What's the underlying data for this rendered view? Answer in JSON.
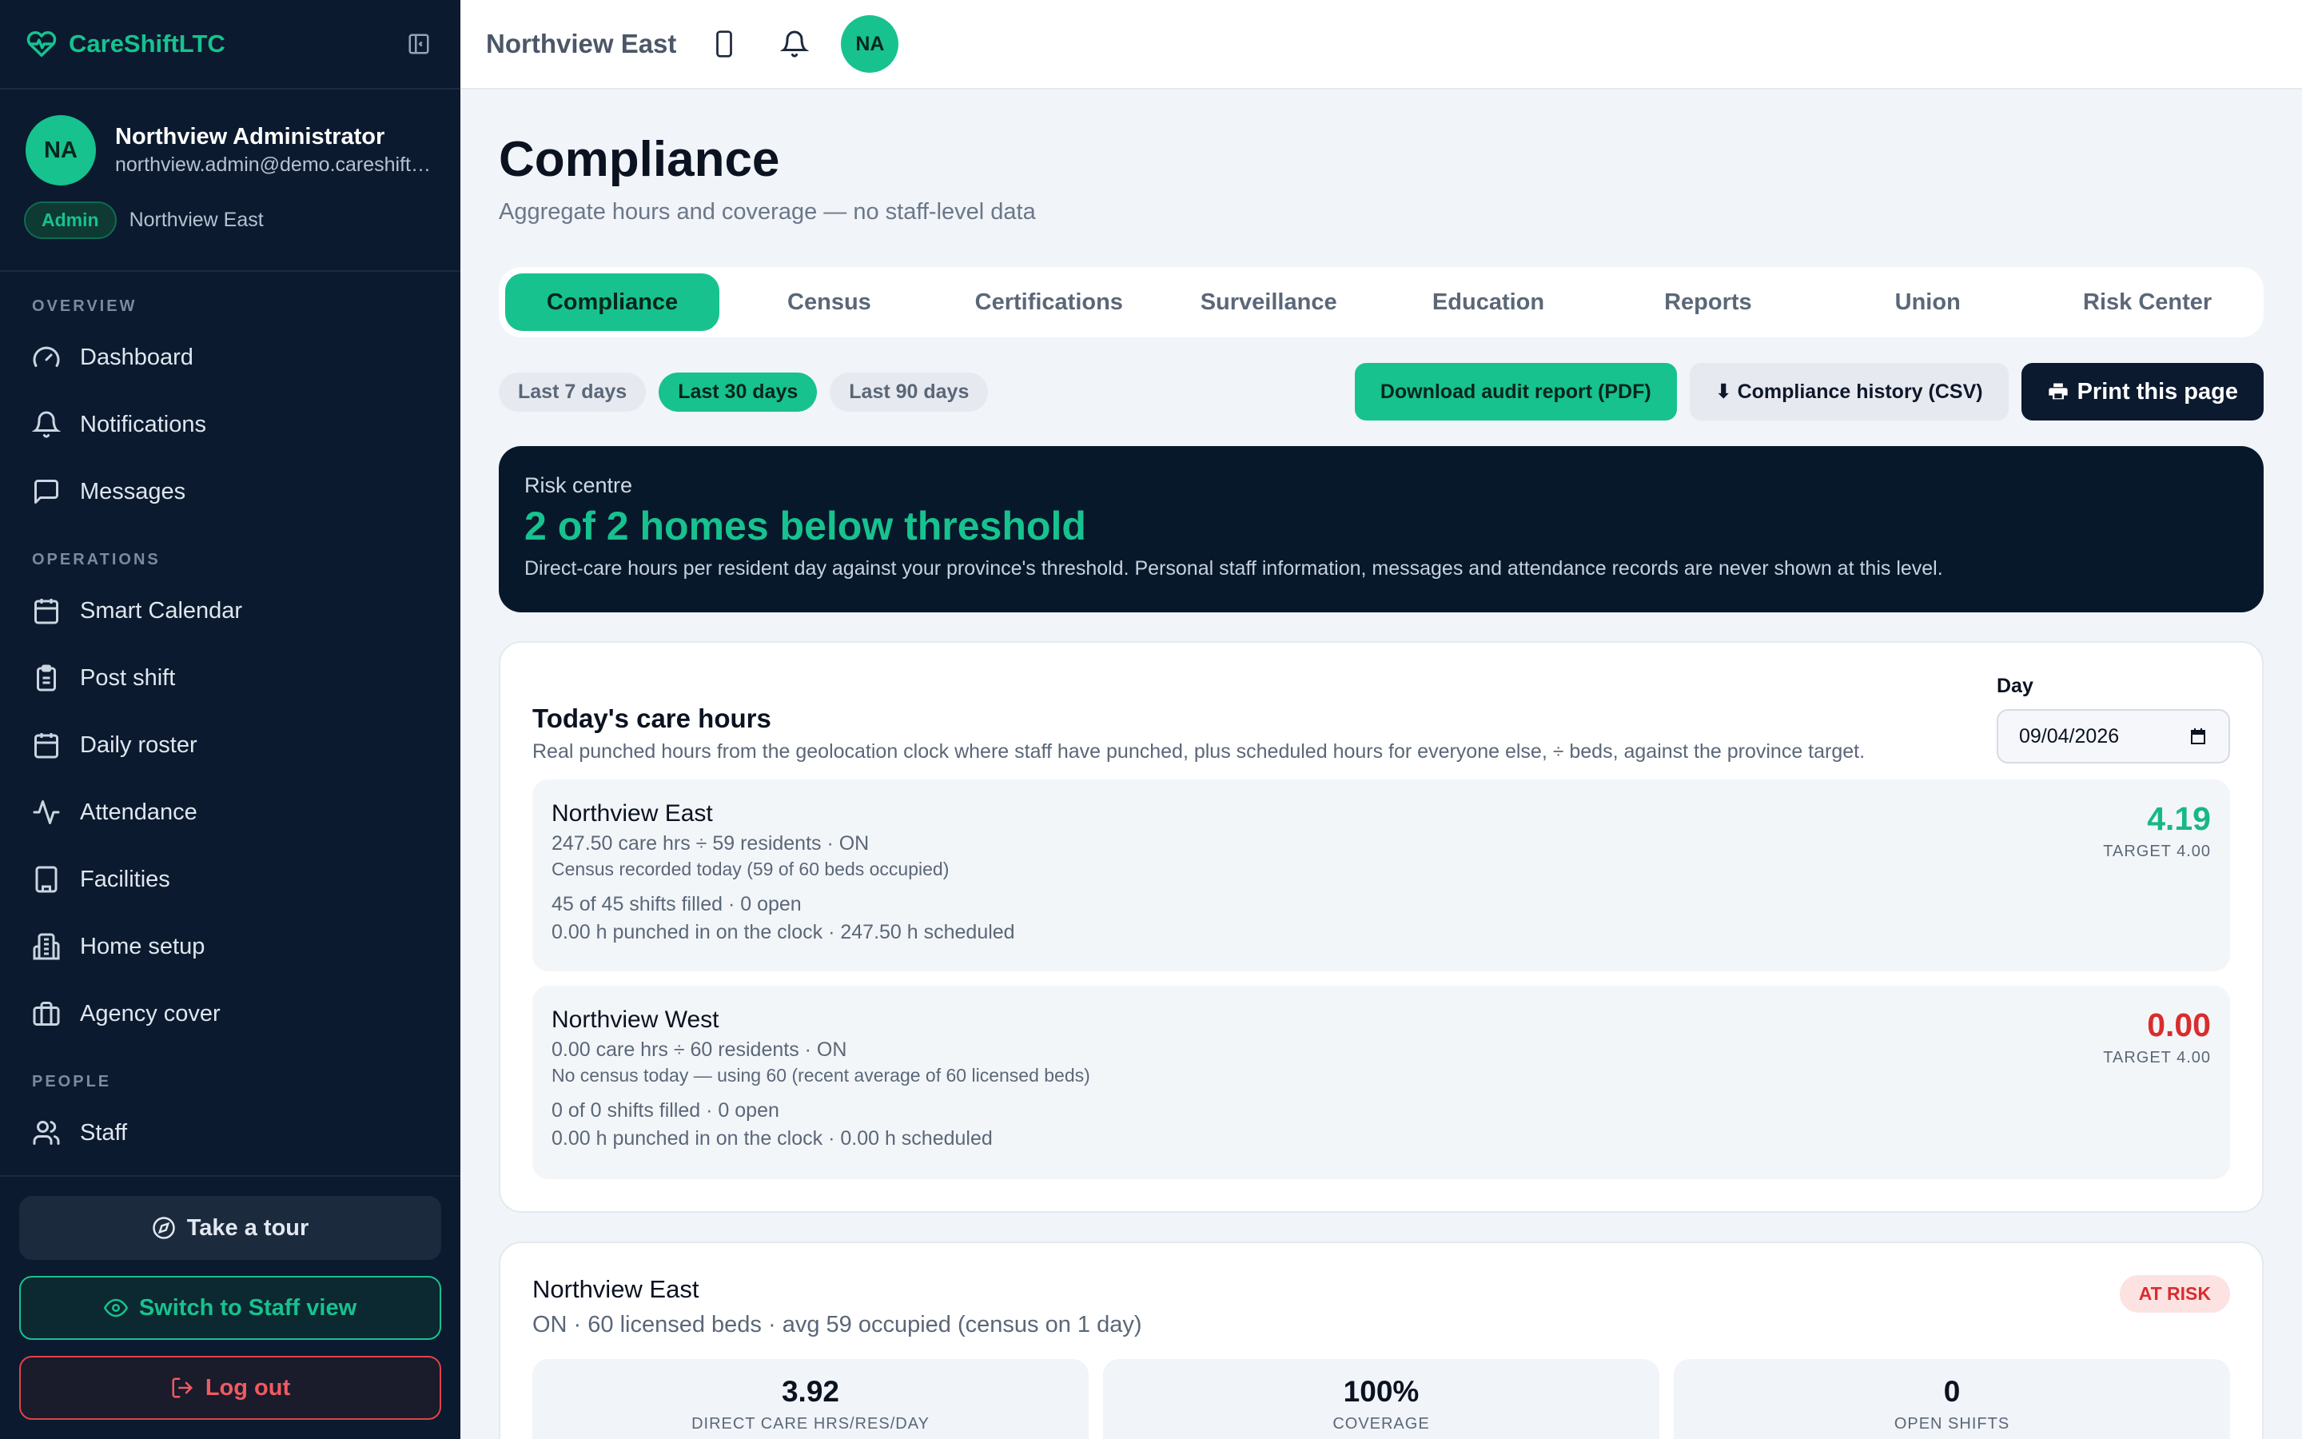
{
  "app": {
    "name": "CareShiftLTC",
    "brand_color": "#17c28f"
  },
  "user": {
    "initials": "NA",
    "name": "Northview Administrator",
    "email": "northview.admin@demo.careshiftltc.com",
    "role": "Admin",
    "home": "Northview East"
  },
  "nav": {
    "overview_label": "OVERVIEW",
    "operations_label": "OPERATIONS",
    "people_label": "PEOPLE",
    "items": [
      {
        "label": "Dashboard",
        "icon": "gauge-icon"
      },
      {
        "label": "Notifications",
        "icon": "bell-icon"
      },
      {
        "label": "Messages",
        "icon": "message-icon"
      },
      {
        "label": "Smart Calendar",
        "icon": "calendar-icon"
      },
      {
        "label": "Post shift",
        "icon": "clipboard-icon"
      },
      {
        "label": "Daily roster",
        "icon": "calendar-icon"
      },
      {
        "label": "Attendance",
        "icon": "activity-icon"
      },
      {
        "label": "Facilities",
        "icon": "building-icon"
      },
      {
        "label": "Home setup",
        "icon": "building-icon"
      },
      {
        "label": "Agency cover",
        "icon": "briefcase-icon"
      },
      {
        "label": "Staff",
        "icon": "users-icon"
      }
    ]
  },
  "sidebar_actions": {
    "tour": "Take a tour",
    "switch": "Switch to Staff view",
    "logout": "Log out"
  },
  "topbar": {
    "home_title": "Northview East",
    "avatar_initials": "NA"
  },
  "page": {
    "title": "Compliance",
    "subtitle": "Aggregate hours and coverage — no staff-level data"
  },
  "tabs": [
    "Compliance",
    "Census",
    "Certifications",
    "Surveillance",
    "Education",
    "Reports",
    "Union",
    "Risk Center"
  ],
  "ranges": [
    "Last 7 days",
    "Last 30 days",
    "Last 90 days"
  ],
  "actions": {
    "pdf": "Download audit report (PDF)",
    "csv": "⬇ Compliance history (CSV)",
    "print": "Print this page"
  },
  "risk": {
    "label": "Risk centre",
    "headline": "2 of 2 homes below threshold",
    "description": "Direct-care hours per resident day against your province's threshold. Personal staff information, messages and attendance records are never shown at this level."
  },
  "care_hours": {
    "title": "Today's care hours",
    "subtitle": "Real punched hours from the geolocation clock where staff have punched, plus scheduled hours for everyone else, ÷ beds, against the province target.",
    "day_label": "Day",
    "day_value": "09/04/2026",
    "homes": [
      {
        "name": "Northview East",
        "line1": "247.50 care hrs ÷ 59 residents · ON",
        "line2": "Census recorded today (59 of 60 beds occupied)",
        "line3": "45 of 45 shifts filled · 0 open",
        "line4": "0.00 h punched in on the clock · 247.50 h scheduled",
        "value": "4.19",
        "target": "TARGET 4.00",
        "status_color": "#17b886"
      },
      {
        "name": "Northview West",
        "line1": "0.00 care hrs ÷ 60 residents · ON",
        "line2": "No census today — using 60 (recent average of 60 licensed beds)",
        "line3": "0 of 0 shifts filled · 0 open",
        "line4": "0.00 h punched in on the clock · 0.00 h scheduled",
        "value": "0.00",
        "target": "TARGET 4.00",
        "status_color": "#d92d2d"
      }
    ]
  },
  "home_summary": {
    "name": "Northview East",
    "subtitle": "ON · 60 licensed beds · avg 59 occupied (census on 1 day)",
    "badge": "AT RISK",
    "stats": [
      {
        "value": "3.92",
        "label": "DIRECT CARE HRS/RES/DAY"
      },
      {
        "value": "100%",
        "label": "COVERAGE"
      },
      {
        "value": "0",
        "label": "OPEN SHIFTS"
      }
    ]
  }
}
